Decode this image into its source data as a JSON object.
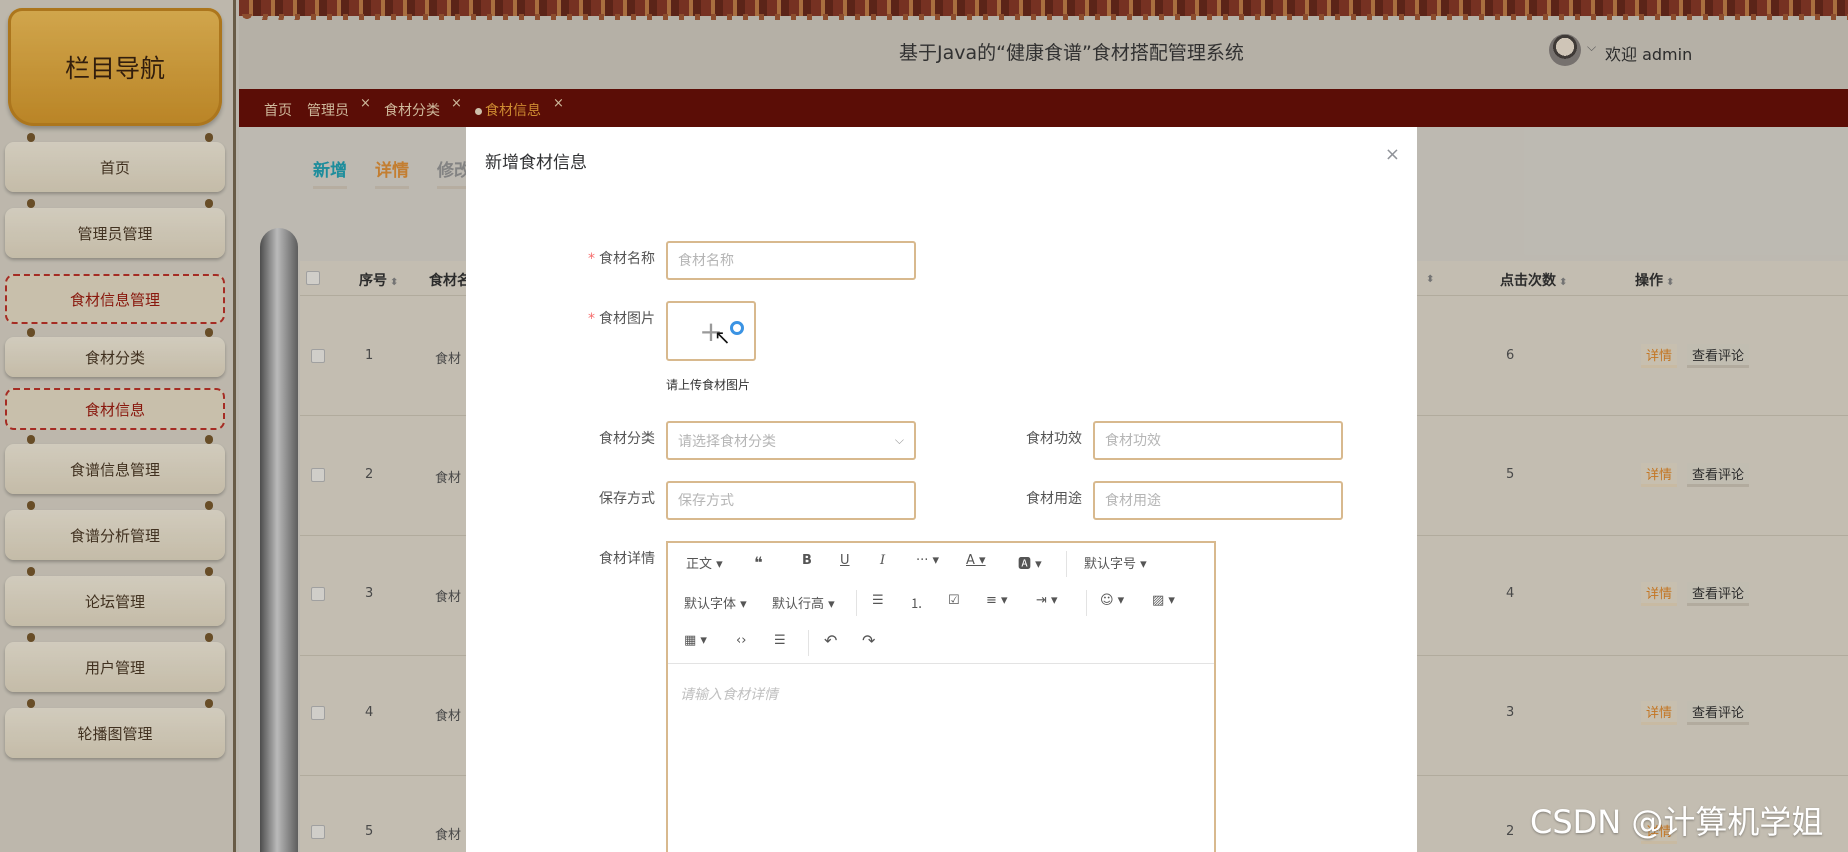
{
  "sidebar": {
    "title": "栏目导航",
    "items": [
      {
        "label": "首页",
        "active": false
      },
      {
        "label": "管理员管理",
        "active": false
      },
      {
        "label": "食材信息管理",
        "active": true
      },
      {
        "label": "食材分类",
        "active": false
      },
      {
        "label": "食材信息",
        "active": true
      },
      {
        "label": "食谱信息管理",
        "active": false
      },
      {
        "label": "食谱分析管理",
        "active": false
      },
      {
        "label": "论坛管理",
        "active": false
      },
      {
        "label": "用户管理",
        "active": false
      },
      {
        "label": "轮播图管理",
        "active": false
      }
    ]
  },
  "header": {
    "title": "基于Java的“健康食谱”食材搭配管理系统",
    "welcome": "欢迎 admin",
    "chevron": "⌵"
  },
  "tags": [
    {
      "label": "首页",
      "closable": false,
      "active": false
    },
    {
      "label": "管理员",
      "closable": true,
      "active": false
    },
    {
      "label": "食材分类",
      "closable": true,
      "active": false
    },
    {
      "label": "食材信息",
      "closable": true,
      "active": true
    }
  ],
  "tag_close": "×",
  "actions": [
    {
      "label": "新增",
      "color": "#23a5b6"
    },
    {
      "label": "详情",
      "color": "#e4933a"
    },
    {
      "label": "修改",
      "color": "#999999"
    }
  ],
  "table": {
    "headers": [
      "序号",
      "食材名",
      "点击次数",
      "操作"
    ],
    "rows": [
      {
        "index": "1",
        "name": "食材",
        "clicks": "6"
      },
      {
        "index": "2",
        "name": "食材",
        "clicks": "5"
      },
      {
        "index": "3",
        "name": "食材",
        "clicks": "4"
      },
      {
        "index": "4",
        "name": "食材",
        "clicks": "3"
      },
      {
        "index": "5",
        "name": "食材",
        "clicks": "2"
      }
    ],
    "detail_label": "详情",
    "comment_label": "查看评论"
  },
  "modal": {
    "title": "新增食材信息",
    "close": "×",
    "fields": {
      "name": {
        "label": "食材名称",
        "placeholder": "食材名称",
        "required": true
      },
      "image": {
        "label": "食材图片",
        "required": true,
        "hint": "请上传食材图片",
        "plus": "+"
      },
      "category": {
        "label": "食材分类",
        "placeholder": "请选择食材分类"
      },
      "effect": {
        "label": "食材功效",
        "placeholder": "食材功效"
      },
      "storage": {
        "label": "保存方式",
        "placeholder": "保存方式"
      },
      "usage": {
        "label": "食材用途",
        "placeholder": "食材用途"
      },
      "detail": {
        "label": "食材详情",
        "placeholder": "请输入食材详情"
      }
    },
    "required_mark": "*",
    "editor_toolbar": {
      "paragraph": "正文 ▾",
      "quote": "❝",
      "bold": "B",
      "underline": "U",
      "italic": "I",
      "more": "··· ▾",
      "font_color": "A ▾",
      "bg_color": "🅰 ▾",
      "font_size": "默认字号 ▾",
      "font_family": "默认字体 ▾",
      "line_height": "默认行高 ▾",
      "bullet_list": "☰",
      "number_list": "⒈",
      "todo": "☑",
      "align": "≡ ▾",
      "indent": "⇥ ▾",
      "emoji": "☺ ▾",
      "image": "▨ ▾",
      "table": "▦ ▾",
      "code": "‹›",
      "divider": "☰",
      "undo": "↶",
      "redo": "↷"
    }
  },
  "watermark": "CSDN @计算机学姐"
}
